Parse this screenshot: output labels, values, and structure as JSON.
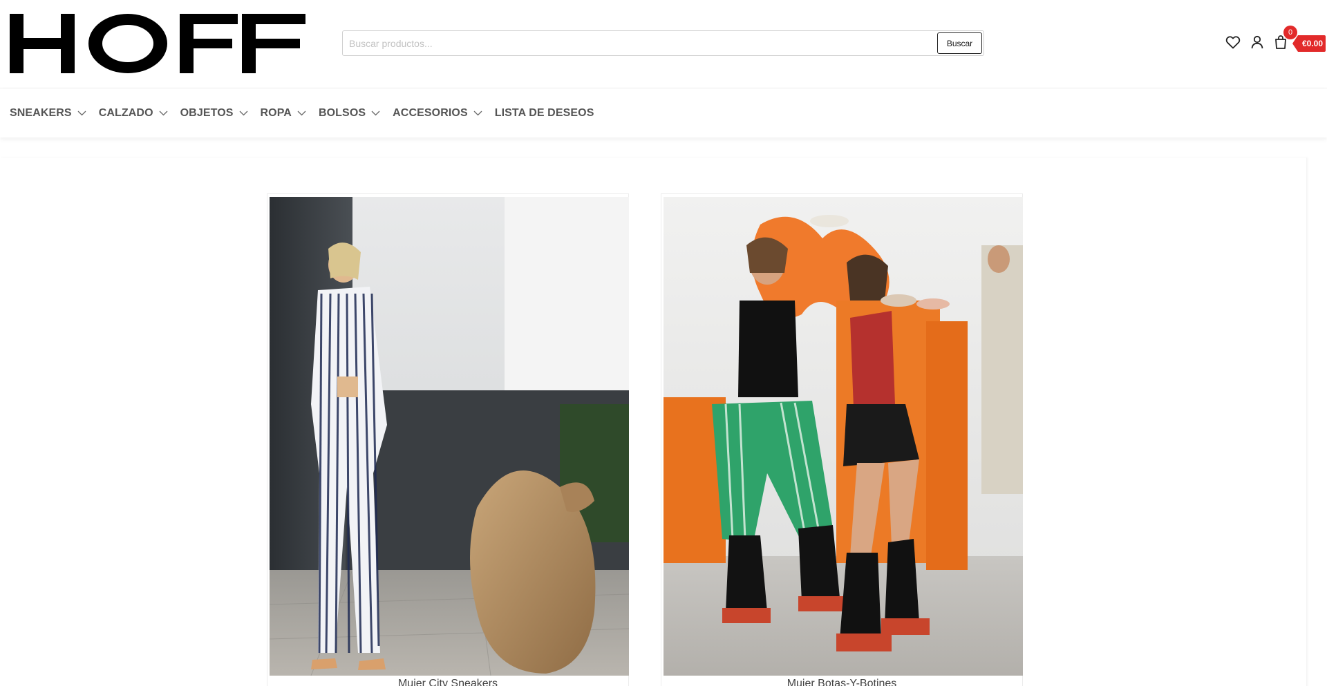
{
  "header": {
    "logo_text": "HOFF",
    "search": {
      "placeholder": "Buscar productos...",
      "value": "",
      "button_label": "Buscar"
    },
    "icons": [
      "heart-icon",
      "user-icon",
      "shopping-bag-icon"
    ],
    "cart": {
      "count": "0",
      "total": "€0.00"
    }
  },
  "nav": {
    "items": [
      {
        "label": "SNEAKERS",
        "has_dropdown": true
      },
      {
        "label": "CALZADO",
        "has_dropdown": true
      },
      {
        "label": "OBJETOS",
        "has_dropdown": true
      },
      {
        "label": "ROPA",
        "has_dropdown": true
      },
      {
        "label": "BOLSOS",
        "has_dropdown": true
      },
      {
        "label": "ACCESORIOS",
        "has_dropdown": true
      },
      {
        "label": "LISTA DE DESEOS",
        "has_dropdown": false
      }
    ]
  },
  "cards": [
    {
      "caption": "Mujer City Sneakers"
    },
    {
      "caption": "Mujer Botas-Y-Botines"
    }
  ],
  "colors": {
    "accent": "#e22a2a",
    "nav_text": "#555555"
  }
}
